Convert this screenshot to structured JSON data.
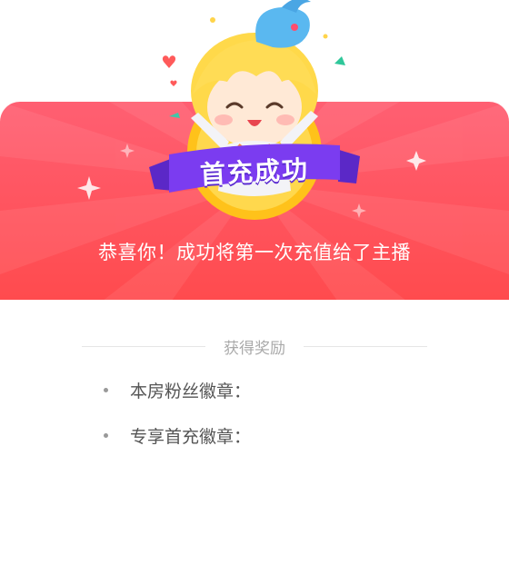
{
  "dialog": {
    "badge_title": "首充成功",
    "message": "恭喜你！成功将第一次充值给了主播",
    "reward_section_title": "获得奖励",
    "rewards": [
      {
        "label": "本房粉丝徽章："
      },
      {
        "label": "专享首充徽章："
      }
    ]
  },
  "colors": {
    "banner_top": "#ff5a6e",
    "banner_bottom": "#ff4a4a",
    "ribbon": "#7b3cf0",
    "coin": "#ffcc33"
  },
  "icons": [
    "mascot-illustration",
    "heart-icon",
    "sparkle-icon",
    "confetti"
  ]
}
